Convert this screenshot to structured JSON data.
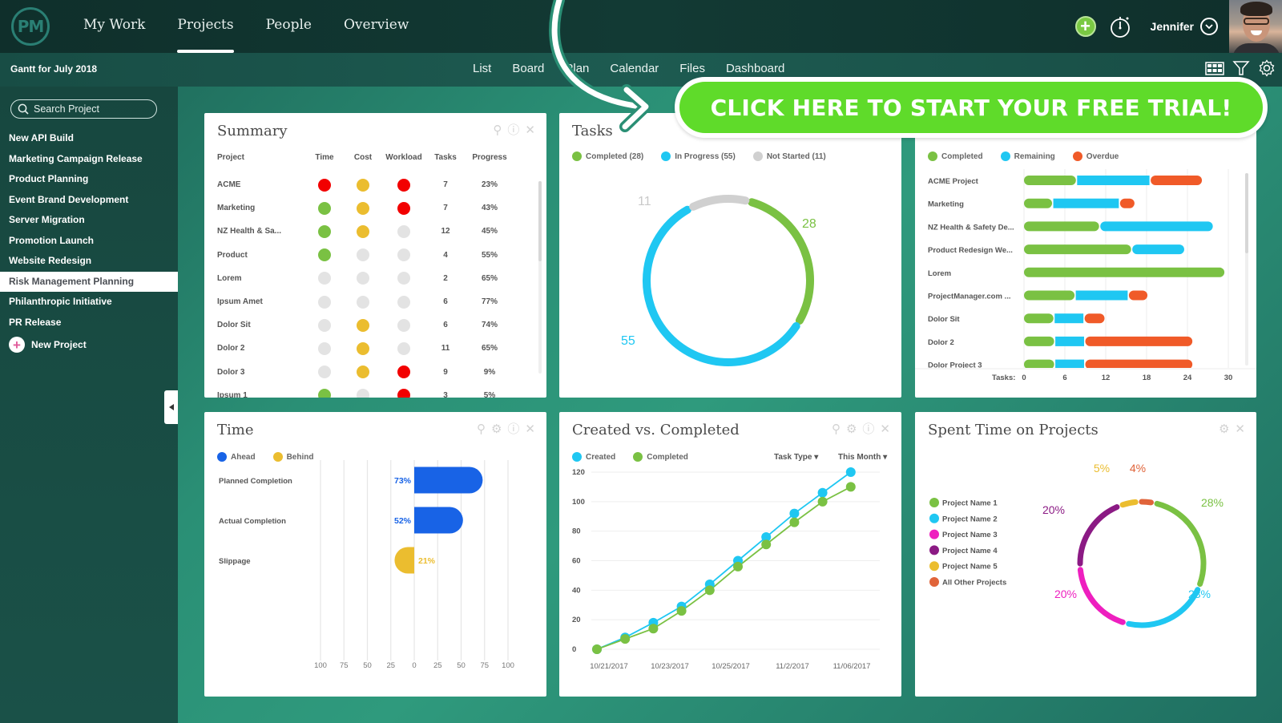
{
  "app": {
    "logo_text": "PM",
    "nav": [
      {
        "label": "My Work",
        "active": false
      },
      {
        "label": "Projects",
        "active": true
      },
      {
        "label": "People",
        "active": false
      },
      {
        "label": "Overview",
        "active": false
      }
    ],
    "user_name": "Jennifer"
  },
  "subbar": {
    "title": "Gantt for July 2018",
    "views": [
      "List",
      "Board",
      "Plan",
      "Calendar",
      "Files",
      "Dashboard"
    ]
  },
  "sidebar": {
    "search_placeholder": "Search Project",
    "projects": [
      {
        "label": "New API Build",
        "active": false
      },
      {
        "label": "Marketing Campaign Release",
        "active": false
      },
      {
        "label": "Product Planning",
        "active": false
      },
      {
        "label": "Event Brand Development",
        "active": false
      },
      {
        "label": "Server Migration",
        "active": false
      },
      {
        "label": "Promotion Launch",
        "active": false
      },
      {
        "label": "Website Redesign",
        "active": false
      },
      {
        "label": "Risk Management Planning",
        "active": true
      },
      {
        "label": "Philanthropic Initiative",
        "active": false
      },
      {
        "label": "PR Release",
        "active": false
      }
    ],
    "new_project_label": "New Project"
  },
  "cta": {
    "label": "CLICK HERE TO START YOUR FREE TRIAL!",
    "color": "#5fdb2a"
  },
  "colors": {
    "green": "#7ac143",
    "blue": "#1fc7f2",
    "gray": "#d0d0d0",
    "red": "#f20000",
    "yellow": "#ebbd2f",
    "orange": "#f05a28",
    "royal_blue": "#1863e6",
    "magenta": "#ee1fbf",
    "purple": "#8b1a84",
    "light_gray": "#e3e3e3"
  },
  "summary": {
    "title": "Summary",
    "columns": [
      "Project",
      "Time",
      "Cost",
      "Workload",
      "Tasks",
      "Progress"
    ],
    "rows": [
      {
        "project": "ACME",
        "time": "red",
        "cost": "yellow",
        "workload": "red",
        "tasks": "7",
        "progress": "23%"
      },
      {
        "project": "Marketing",
        "time": "green",
        "cost": "yellow",
        "workload": "red",
        "tasks": "7",
        "progress": "43%"
      },
      {
        "project": "NZ Health & Sa...",
        "time": "green",
        "cost": "yellow",
        "workload": "none",
        "tasks": "12",
        "progress": "45%"
      },
      {
        "project": "Product",
        "time": "green",
        "cost": "none",
        "workload": "none",
        "tasks": "4",
        "progress": "55%"
      },
      {
        "project": "Lorem",
        "time": "none",
        "cost": "none",
        "workload": "none",
        "tasks": "2",
        "progress": "65%"
      },
      {
        "project": "Ipsum Amet",
        "time": "none",
        "cost": "none",
        "workload": "none",
        "tasks": "6",
        "progress": "77%"
      },
      {
        "project": "Dolor Sit",
        "time": "none",
        "cost": "yellow",
        "workload": "none",
        "tasks": "6",
        "progress": "74%"
      },
      {
        "project": "Dolor 2",
        "time": "none",
        "cost": "yellow",
        "workload": "none",
        "tasks": "11",
        "progress": "65%"
      },
      {
        "project": "Dolor 3",
        "time": "none",
        "cost": "yellow",
        "workload": "red",
        "tasks": "9",
        "progress": "9%"
      },
      {
        "project": "Ipsum 1",
        "time": "green",
        "cost": "none",
        "workload": "red",
        "tasks": "3",
        "progress": "5%"
      }
    ]
  },
  "chart_data": [
    {
      "id": "tasks",
      "type": "pie",
      "title": "Tasks",
      "donut": true,
      "legend": [
        "Completed (28)",
        "In Progress (55)",
        "Not Started (11)"
      ],
      "categories": [
        "Completed",
        "In Progress",
        "Not Started"
      ],
      "values": [
        28,
        55,
        11
      ],
      "labels": [
        "28",
        "55",
        "11"
      ],
      "colors": [
        "#7ac143",
        "#1fc7f2",
        "#d0d0d0"
      ],
      "legend_position": "top-left"
    },
    {
      "id": "project-tasks",
      "type": "bar",
      "orientation": "horizontal",
      "stacked": true,
      "title": "",
      "xlabel": "Tasks:",
      "xlim": [
        0,
        30
      ],
      "xticks": [
        0,
        6,
        12,
        18,
        24,
        30
      ],
      "categories": [
        "ACME Project",
        "Marketing",
        "NZ Health & Safety De...",
        "Product Redesign We...",
        "Lorem",
        "ProjectManager.com ...",
        "Dolor Sit",
        "Dolor 2",
        "Dolor Project 3"
      ],
      "series": [
        {
          "name": "Completed",
          "color": "#7ac143",
          "values": [
            7.8,
            4.3,
            11.2,
            15.9,
            29.6,
            7.6,
            4.5,
            4.6,
            4.6
          ]
        },
        {
          "name": "Remaining",
          "color": "#1fc7f2",
          "values": [
            10.8,
            9.8,
            16.7,
            7.8,
            0,
            7.8,
            4.4,
            4.4,
            4.4
          ]
        },
        {
          "name": "Overdue",
          "color": "#f05a28",
          "values": [
            7.7,
            2.3,
            0,
            0,
            0,
            2.9,
            3.1,
            15.9,
            15.9
          ]
        }
      ],
      "legend_position": "top-left"
    },
    {
      "id": "time",
      "type": "bar",
      "orientation": "horizontal",
      "diverging": true,
      "title": "Time",
      "xlim": [
        -100,
        100
      ],
      "xticks": [
        "100",
        "75",
        "50",
        "25",
        "0",
        "25",
        "50",
        "75",
        "100"
      ],
      "legend": [
        "Ahead",
        "Behind"
      ],
      "legend_colors": [
        "#1863e6",
        "#ebbd2f"
      ],
      "categories": [
        "Planned Completion",
        "Actual Completion",
        "Slippage"
      ],
      "values": [
        73,
        52,
        -21
      ],
      "labels": [
        "73%",
        "52%",
        "21%"
      ],
      "legend_position": "top-left"
    },
    {
      "id": "created-vs-completed",
      "type": "line",
      "title": "Created vs. Completed",
      "ylim": [
        0,
        120
      ],
      "yticks": [
        0,
        20,
        40,
        60,
        80,
        100,
        120
      ],
      "xtick_labels": [
        "10/21/2017",
        "10/23/2017",
        "10/25/2017",
        "11/2/2017",
        "11/06/2017"
      ],
      "x": [
        0,
        1,
        2,
        3,
        4,
        5,
        6,
        7,
        8,
        9,
        10
      ],
      "series": [
        {
          "name": "Created",
          "color": "#1fc7f2",
          "values": [
            0,
            8,
            18,
            29,
            44,
            60,
            76,
            92,
            106,
            120
          ]
        },
        {
          "name": "Completed",
          "color": "#7ac143",
          "values": [
            0,
            7,
            14,
            26,
            40,
            56,
            71,
            86,
            100,
            110
          ]
        }
      ],
      "filters": [
        "Task Type",
        "This Month"
      ],
      "legend_position": "top-left"
    },
    {
      "id": "spent-time",
      "type": "pie",
      "donut": true,
      "title": "Spent Time on Projects",
      "categories": [
        "Project Name 1",
        "Project Name 2",
        "Project Name 3",
        "Project Name 4",
        "Project Name 5",
        "All Other Projects"
      ],
      "values": [
        28,
        23,
        20,
        20,
        5,
        4
      ],
      "labels": [
        "28%",
        "23%",
        "20%",
        "20%",
        "5%",
        "4%"
      ],
      "colors": [
        "#7ac143",
        "#1fc7f2",
        "#ee1fbf",
        "#8b1a84",
        "#ebbd2f",
        "#e0643a"
      ],
      "legend_position": "left"
    }
  ]
}
